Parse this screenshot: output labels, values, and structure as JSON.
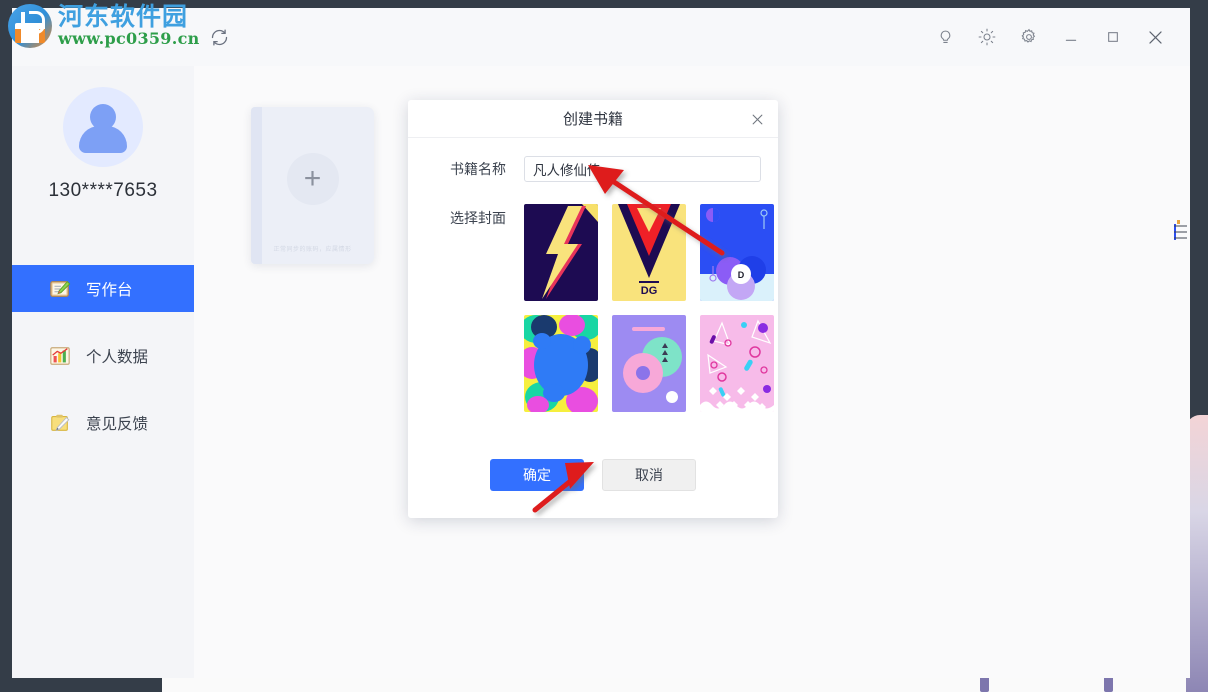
{
  "watermark": {
    "site_name": "河东软件园",
    "url": "www.pc0359.cn",
    "logo_icon": "hedong-logo-icon"
  },
  "titlebar": {
    "refresh_icon": "refresh-icon",
    "actions": [
      {
        "name": "bulb-icon",
        "glyph": "bulb"
      },
      {
        "name": "brightness-icon",
        "glyph": "sun"
      },
      {
        "name": "settings-gear-icon",
        "glyph": "gear"
      },
      {
        "name": "minimize-icon",
        "glyph": "minimize"
      },
      {
        "name": "maximize-icon",
        "glyph": "maximize"
      },
      {
        "name": "close-icon",
        "glyph": "close"
      }
    ]
  },
  "sidebar": {
    "avatar_icon": "user-avatar-icon",
    "phone": "130****7653",
    "items": [
      {
        "label": "写作台",
        "icon": "notebook-pencil-icon",
        "glyph": "📝",
        "active": true
      },
      {
        "label": "个人数据",
        "icon": "bar-chart-icon",
        "glyph": "📊",
        "active": false
      },
      {
        "label": "意见反馈",
        "icon": "feedback-clipboard-icon",
        "glyph": "📝",
        "active": false
      }
    ]
  },
  "main": {
    "add_book_card": {
      "name": "add-book-card",
      "plus_icon": "plus-icon",
      "plus_glyph": "+",
      "note": "正常同步的账码，应属情形"
    }
  },
  "dialog": {
    "title": "创建书籍",
    "close_icon": "close-icon",
    "name_field": {
      "label": "书籍名称",
      "value": "凡人修仙传",
      "placeholder": ""
    },
    "cover_field": {
      "label": "选择封面",
      "covers": [
        {
          "name": "cover-lightning",
          "alt": "navy lightning bolt"
        },
        {
          "name": "cover-dg-triangle",
          "alt": "yellow DG triangle"
        },
        {
          "name": "cover-blue-d-circles",
          "alt": "blue with D circle"
        },
        {
          "name": "cover-blob-rainbow",
          "alt": "colorful blobs"
        },
        {
          "name": "cover-purple-circles",
          "alt": "purple with circles"
        },
        {
          "name": "cover-pink-confetti",
          "alt": "pink confetti shapes"
        }
      ]
    },
    "confirm_label": "确定",
    "cancel_label": "取消"
  },
  "colors": {
    "accent": "#3370ff",
    "sidebar_bg": "#f4f5f8",
    "window_bg": "#fafafb",
    "frame": "#343d48",
    "annotation_red": "#e01b1b"
  }
}
